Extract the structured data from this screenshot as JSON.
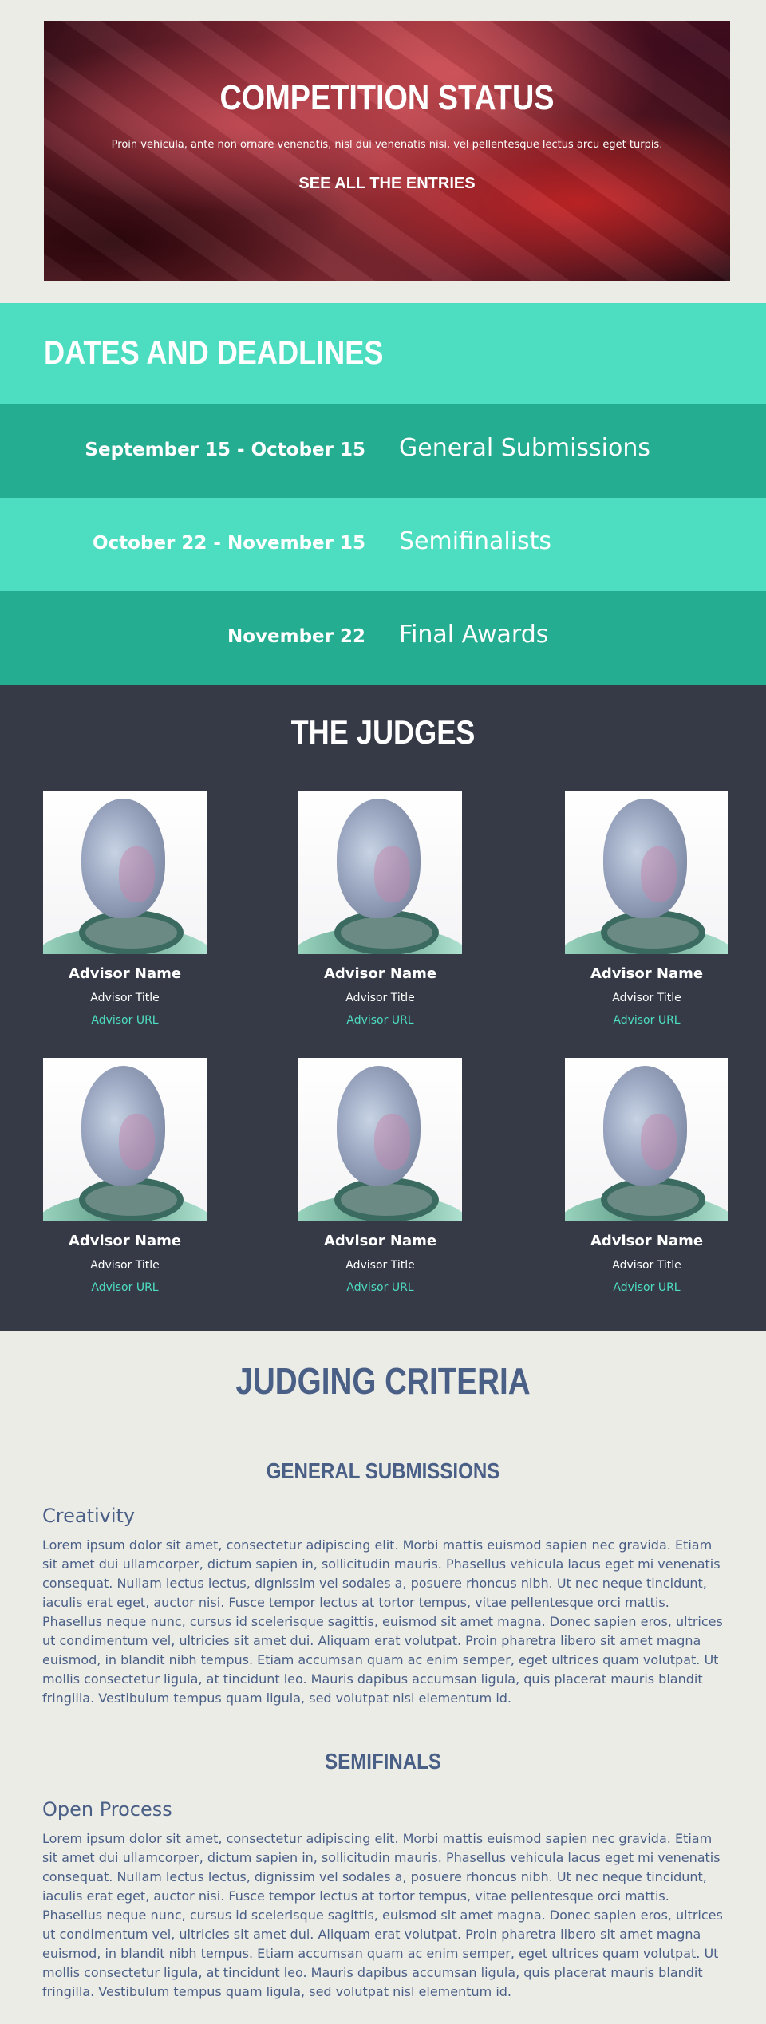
{
  "hero": {
    "title": "COMPETITION STATUS",
    "text": "Proin vehicula, ante non ornare venenatis, nisl dui venenatis nisi, vel pellentesque lectus arcu eget turpis.",
    "link": "SEE ALL THE ENTRIES"
  },
  "dates": {
    "heading": "DATES AND DEADLINES",
    "rows": [
      {
        "when": "September 15 - October 15",
        "what": "General Submissions"
      },
      {
        "when": "October 22 - November 15",
        "what": "Semifinalists"
      },
      {
        "when": "November 22",
        "what": "Final Awards"
      }
    ]
  },
  "judges": {
    "heading": "THE JUDGES",
    "items": [
      {
        "name": "Advisor Name",
        "title": "Advisor Title",
        "url": "Advisor URL"
      },
      {
        "name": "Advisor Name",
        "title": "Advisor Title",
        "url": "Advisor URL"
      },
      {
        "name": "Advisor Name",
        "title": "Advisor Title",
        "url": "Advisor URL"
      },
      {
        "name": "Advisor Name",
        "title": "Advisor Title",
        "url": "Advisor URL"
      },
      {
        "name": "Advisor Name",
        "title": "Advisor Title",
        "url": "Advisor URL"
      },
      {
        "name": "Advisor Name",
        "title": "Advisor Title",
        "url": "Advisor URL"
      }
    ]
  },
  "criteria": {
    "heading": "JUDGING CRITERIA",
    "sections": [
      {
        "heading": "GENERAL SUBMISSIONS",
        "subheading": "Creativity",
        "body": "Lorem ipsum dolor sit amet, consectetur adipiscing elit. Morbi mattis euismod sapien nec gravida. Etiam sit amet dui ullamcorper, dictum sapien in, sollicitudin mauris. Phasellus vehicula lacus eget mi venenatis consequat. Nullam lectus lectus, dignissim vel sodales a, posuere rhoncus nibh. Ut nec neque tincidunt, iaculis erat eget, auctor nisi. Fusce tempor lectus at tortor tempus, vitae pellentesque orci mattis. Phasellus neque nunc, cursus id scelerisque sagittis, euismod sit amet magna. Donec sapien eros, ultrices ut condimentum vel, ultricies sit amet dui. Aliquam erat volutpat. Proin pharetra libero sit amet magna euismod, in blandit nibh tempus. Etiam accumsan quam ac enim semper, eget ultrices quam volutpat. Ut mollis consectetur ligula, at tincidunt leo. Mauris dapibus accumsan ligula, quis placerat mauris blandit fringilla. Vestibulum tempus quam ligula, sed volutpat nisl elementum id."
      },
      {
        "heading": "SEMIFINALS",
        "subheading": "Open Process",
        "body": "Lorem ipsum dolor sit amet, consectetur adipiscing elit. Morbi mattis euismod sapien nec gravida. Etiam sit amet dui ullamcorper, dictum sapien in, sollicitudin mauris. Phasellus vehicula lacus eget mi venenatis consequat. Nullam lectus lectus, dignissim vel sodales a, posuere rhoncus nibh. Ut nec neque tincidunt, iaculis erat eget, auctor nisi. Fusce tempor lectus at tortor tempus, vitae pellentesque orci mattis. Phasellus neque nunc, cursus id scelerisque sagittis, euismod sit amet magna. Donec sapien eros, ultrices ut condimentum vel, ultricies sit amet dui. Aliquam erat volutpat. Proin pharetra libero sit amet magna euismod, in blandit nibh tempus. Etiam accumsan quam ac enim semper, eget ultrices quam volutpat. Ut mollis consectetur ligula, at tincidunt leo. Mauris dapibus accumsan ligula, quis placerat mauris blandit fringilla. Vestibulum tempus quam ligula, sed volutpat nisl elementum id."
      }
    ]
  },
  "colors": {
    "mint": "#4ddec2",
    "teal": "#25ad92",
    "slate": "#363a47",
    "navy_text": "#4a5f86",
    "page_bg": "#ecece7"
  }
}
